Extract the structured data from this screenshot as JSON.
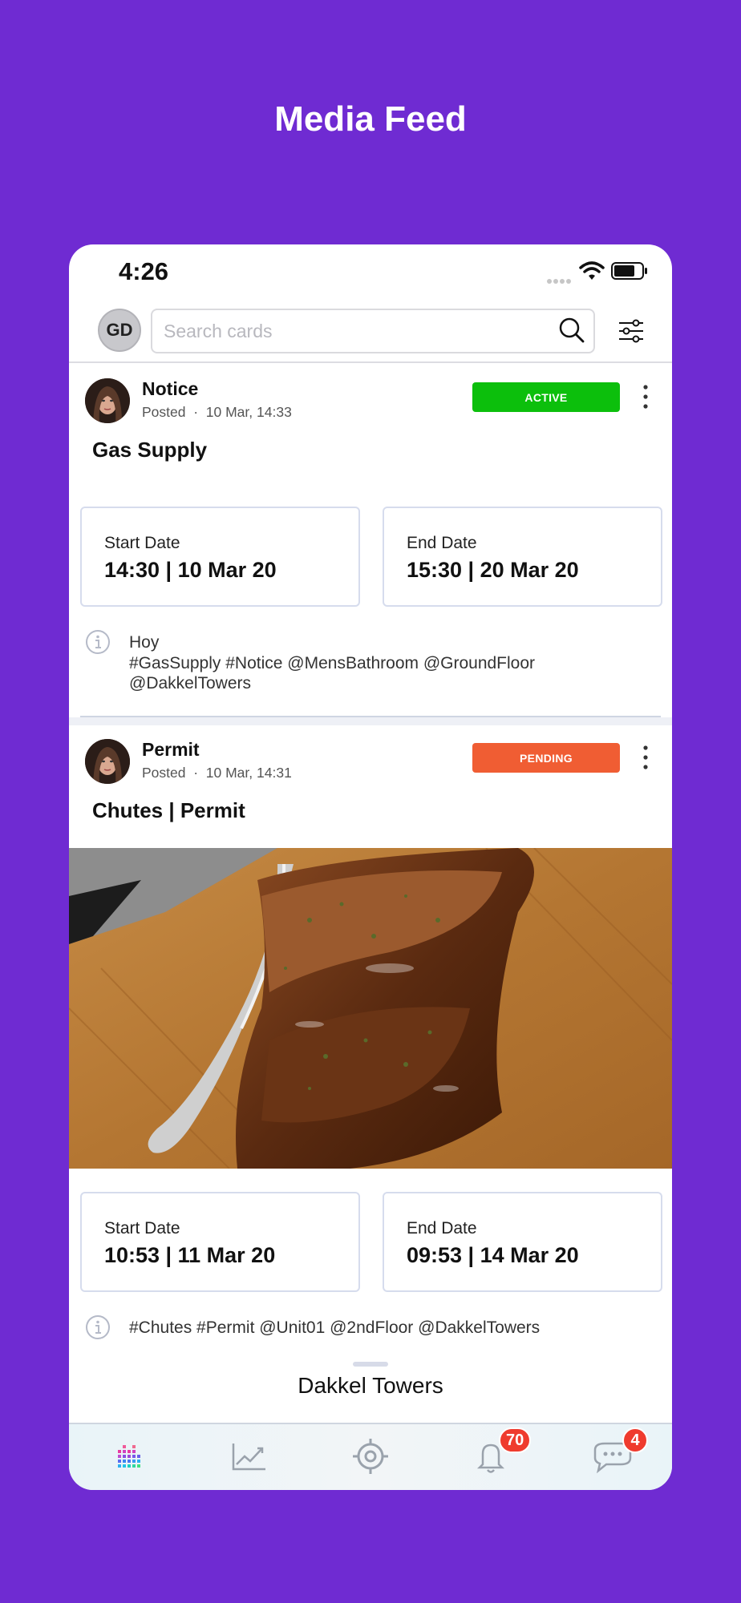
{
  "page_title": "Media Feed",
  "status_bar": {
    "time": "4:26"
  },
  "user": {
    "initials": "GD"
  },
  "search": {
    "placeholder": "Search cards"
  },
  "cards": [
    {
      "type": "Notice",
      "posted_label": "Posted",
      "separator": "·",
      "posted_time": "10 Mar, 14:33",
      "status": "ACTIVE",
      "status_color": "#0cbf0c",
      "title": "Gas Supply",
      "start_label": "Start Date",
      "start_value": "14:30 | 10 Mar 20",
      "end_label": "End Date",
      "end_value": "15:30 | 20 Mar 20",
      "description": [
        "Hoy",
        "#GasSupply #Notice @MensBathroom @GroundFloor",
        "@DakkelTowers"
      ]
    },
    {
      "type": "Permit",
      "posted_label": "Posted",
      "separator": "·",
      "posted_time": "10 Mar, 14:31",
      "status": "PENDING",
      "status_color": "#f05d33",
      "title": "Chutes | Permit",
      "start_label": "Start Date",
      "start_value": "10:53 | 11 Mar 20",
      "end_label": "End Date",
      "end_value": "09:53 | 14 Mar 20",
      "description": [
        "#Chutes #Permit @Unit01 @2ndFloor @DakkelTowers"
      ]
    }
  ],
  "building": {
    "name": "Dakkel Towers"
  },
  "tabs": [
    {
      "icon": "dashboard-bars-icon"
    },
    {
      "icon": "analytics-chart-icon"
    },
    {
      "icon": "target-icon"
    },
    {
      "icon": "bell-icon",
      "badge": "70"
    },
    {
      "icon": "chat-icon",
      "badge": "4"
    }
  ],
  "colors": {
    "background": "#6f2bd2",
    "active": "#0cbf0c",
    "pending": "#f05d33",
    "badge": "#ef3b2e"
  }
}
